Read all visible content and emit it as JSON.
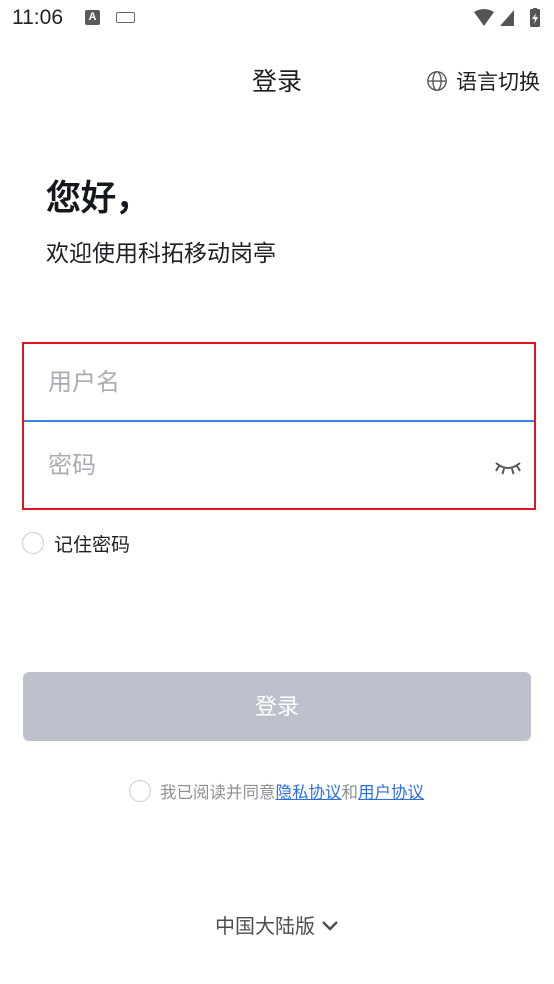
{
  "status_bar": {
    "time": "11:06",
    "notification_letter": "A"
  },
  "header": {
    "title": "登录",
    "language_label": "语言切换"
  },
  "greeting": {
    "hello": "您好，",
    "welcome": "欢迎使用科拓移动岗亭"
  },
  "form": {
    "username_placeholder": "用户名",
    "password_placeholder": "密码",
    "remember_label": "记住密码"
  },
  "login_button": "登录",
  "agreement": {
    "prefix": "我已阅读并同意",
    "privacy_link": "隐私协议",
    "conjunction": "和",
    "user_link": "用户协议"
  },
  "footer": {
    "region": "中国大陆版"
  },
  "colors": {
    "accent": "#3b7fe0",
    "highlight_border": "#e2131a",
    "button_disabled": "#bcc1cb",
    "link": "#2d6fd8"
  }
}
